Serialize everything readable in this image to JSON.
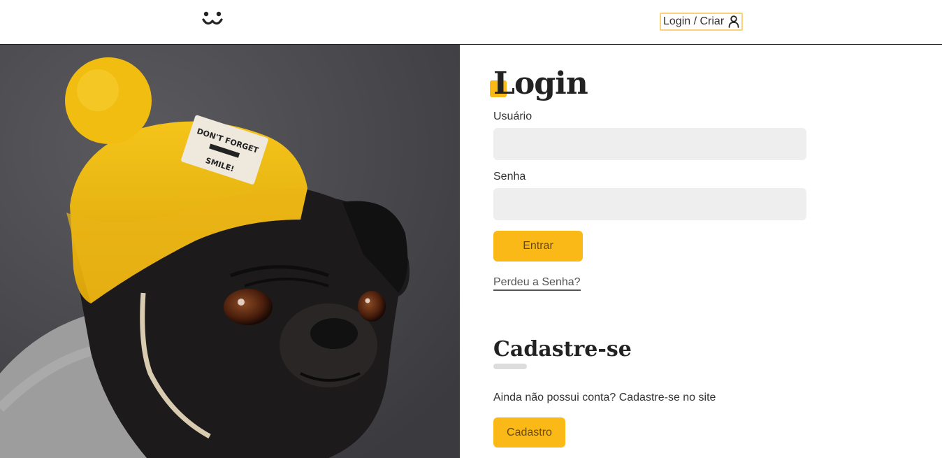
{
  "header": {
    "logo_icon": "dog-face-icon",
    "login_label": "Login / Criar",
    "user_icon": "user-icon"
  },
  "photo": {
    "subject": "pug",
    "hat_label_line1": "DON'T FORGET",
    "hat_label_line2": "SMILE!"
  },
  "login": {
    "title": "Login",
    "username_label": "Usuário",
    "username_value": "",
    "password_label": "Senha",
    "password_value": "",
    "submit_label": "Entrar",
    "lost_password_label": "Perdeu a Senha?"
  },
  "signup": {
    "title": "Cadastre-se",
    "text": "Ainda não possui conta? Cadastre-se no site",
    "button_label": "Cadastro"
  },
  "colors": {
    "accent": "#fbb917",
    "input_bg": "#eeeeee",
    "text": "#333333",
    "title": "#222222"
  }
}
